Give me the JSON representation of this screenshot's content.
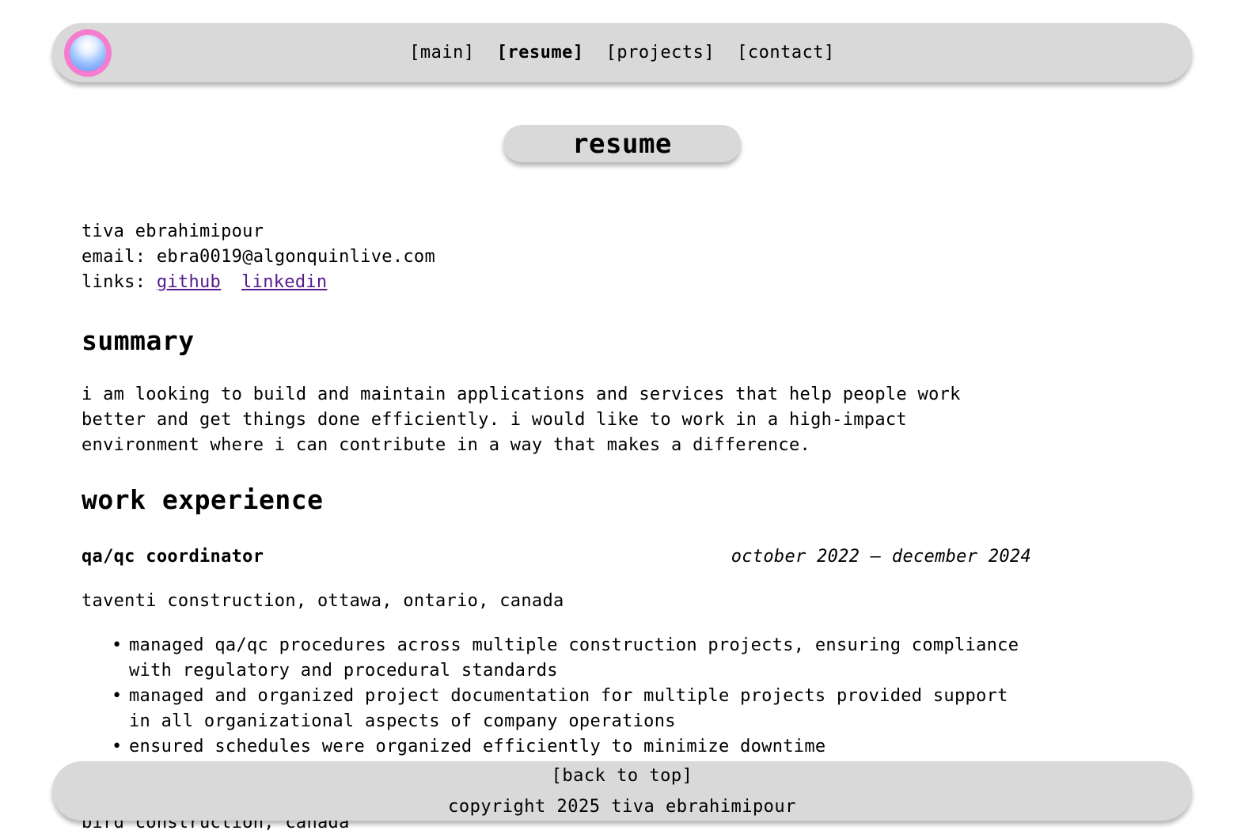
{
  "nav": {
    "items": [
      "[main]",
      "[resume]",
      "[projects]",
      "[contact]"
    ]
  },
  "page_title": "resume",
  "contact": {
    "name": "tiva ebrahimipour",
    "email_label": "email:",
    "email": "ebra0019@algonquinlive.com",
    "links_label": "links:",
    "github": "github",
    "linkedin": "linkedin"
  },
  "summary": {
    "heading": "summary",
    "text": "i am looking to build and maintain applications and services that help people work better and get things done efficiently. i would like to work in a high-impact environment where i can contribute in a way that makes a difference."
  },
  "work": {
    "heading": "work experience",
    "jobs": [
      {
        "title": "qa/qc coordinator",
        "dates": "october 2022 – december 2024",
        "company": "taventi construction, ottawa, ontario, canada",
        "bullets": [
          "managed qa/qc procedures across multiple construction projects, ensuring compliance with regulatory and procedural standards",
          "managed and organized project documentation for multiple projects provided support in all organizational aspects of company operations",
          "ensured schedules were organized efficiently to minimize downtime"
        ]
      }
    ],
    "next_company": "bird construction, canada"
  },
  "footer": {
    "back_to_top": "[back to top]",
    "copyright": "copyright 2025 tiva ebrahimipour"
  },
  "colors": {
    "bar_bg": "#d9d9d9",
    "link": "#551a8b",
    "logo_ring": "#f57ccf",
    "logo_orb": "#9ec4ff"
  }
}
